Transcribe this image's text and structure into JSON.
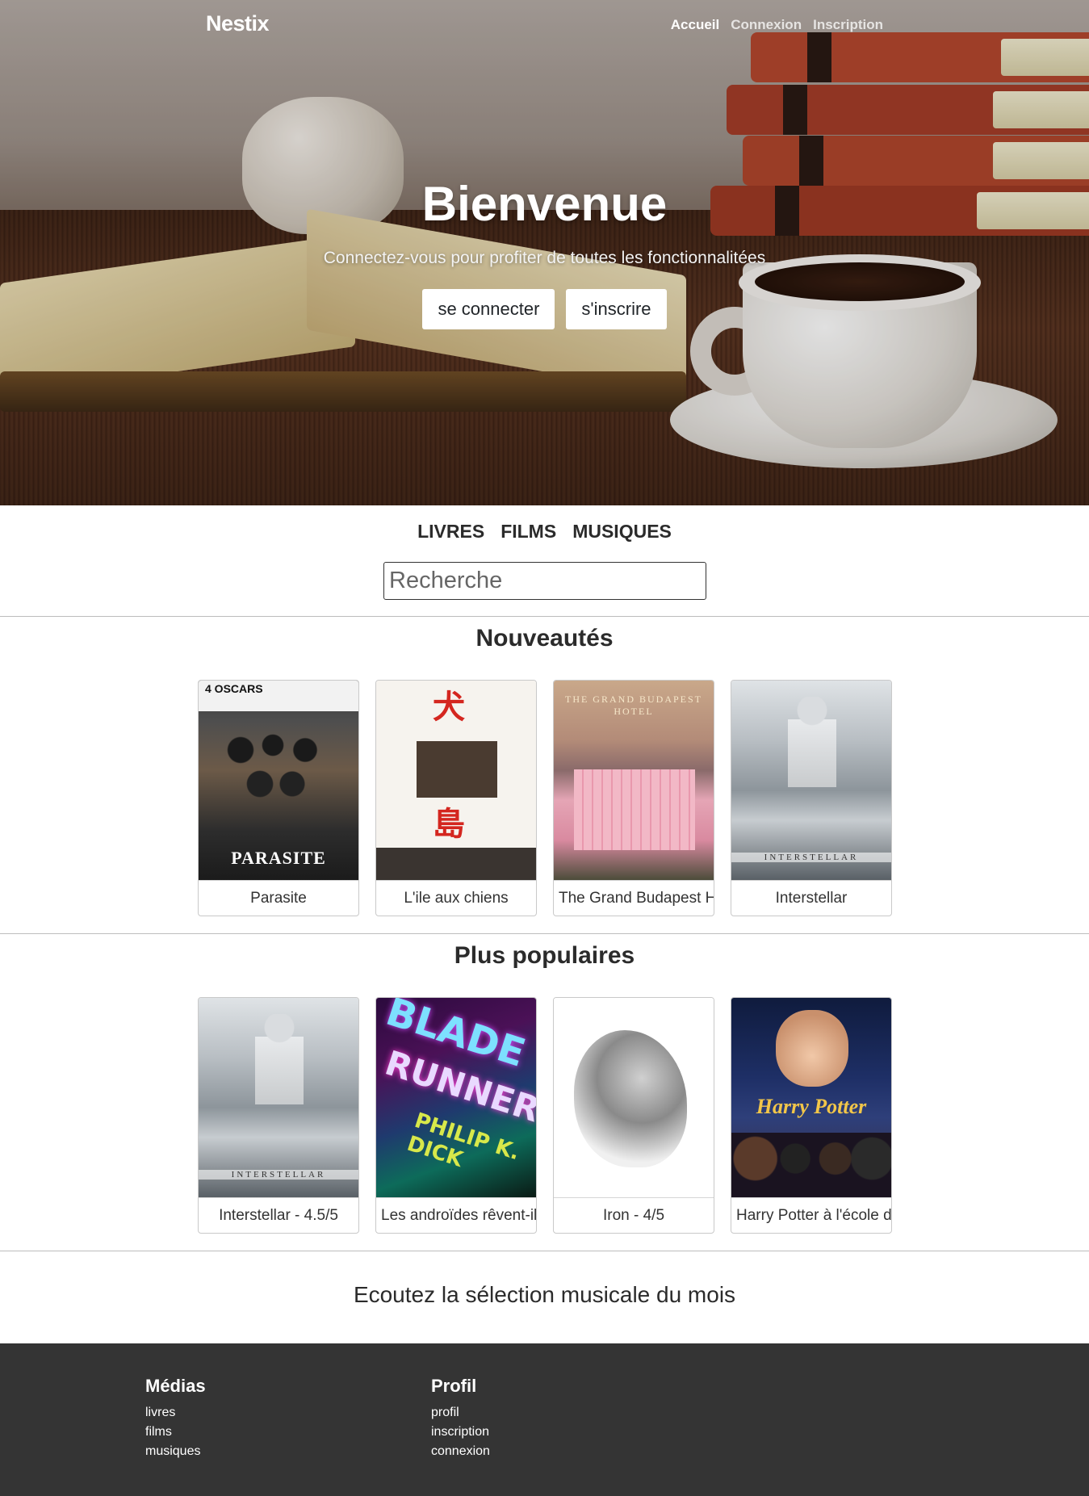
{
  "navbar": {
    "brand": "Nestix",
    "links": [
      "Accueil",
      "Connexion",
      "Inscription"
    ]
  },
  "hero": {
    "title": "Bienvenue",
    "subtitle": "Connectez-vous pour profiter de toutes les fonctionnalitées",
    "login_button": "se connecter",
    "signup_button": "s'inscrire"
  },
  "categories": [
    "LIVRES",
    "FILMS",
    "MUSIQUES"
  ],
  "search": {
    "placeholder": "Recherche"
  },
  "new_section": {
    "title": "Nouveautés",
    "items": [
      "Parasite",
      "L'ile aux chiens",
      "The Grand Budapest Hotel",
      "Interstellar"
    ]
  },
  "popular_section": {
    "title": "Plus populaires",
    "items": [
      "Interstellar - 4.5/5",
      "Les androïdes rêvent-ils de moutons électriques ?",
      "Iron - 4/5",
      "Harry Potter à l'école des sorciers"
    ]
  },
  "posters": {
    "parasite_title": "PARASITE",
    "parasite_oscars": "4 OSCARS",
    "isle_kanji_top": "犬",
    "isle_kanji_bottom": "島",
    "budapest_title": "THE GRAND BUDAPEST HOTEL",
    "interstellar_title": "INTERSTELLAR",
    "blade_line1": "BLADE",
    "blade_line2": "RUNNER",
    "blade_author": "PHILIP K. DICK",
    "hp_title": "Harry Potter"
  },
  "music": {
    "text": "Ecoutez la sélection musicale du mois"
  },
  "footer": {
    "medias": {
      "title": "Médias",
      "links": [
        "livres",
        "films",
        "musiques"
      ]
    },
    "profil": {
      "title": "Profil",
      "links": [
        "profil",
        "inscription",
        "connexion"
      ]
    }
  }
}
